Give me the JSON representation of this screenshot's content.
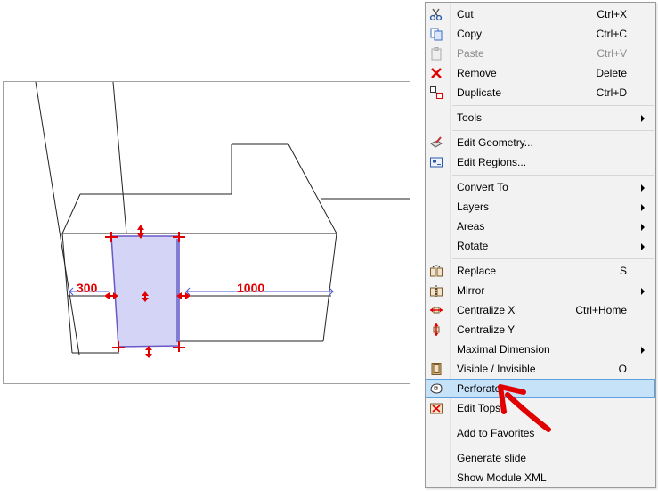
{
  "viewport": {
    "dimensions": [
      {
        "label": "300"
      },
      {
        "label": "1000"
      }
    ]
  },
  "menu": {
    "items": [
      {
        "kind": "item",
        "icon": "scissors-icon",
        "label": "Cut",
        "shortcut": "Ctrl+X",
        "submenu": false,
        "disabled": false
      },
      {
        "kind": "item",
        "icon": "copy-icon",
        "label": "Copy",
        "shortcut": "Ctrl+C",
        "submenu": false,
        "disabled": false
      },
      {
        "kind": "item",
        "icon": "paste-icon",
        "label": "Paste",
        "shortcut": "Ctrl+V",
        "submenu": false,
        "disabled": true
      },
      {
        "kind": "item",
        "icon": "remove-x-icon",
        "label": "Remove",
        "shortcut": "Delete",
        "submenu": false,
        "disabled": false
      },
      {
        "kind": "item",
        "icon": "duplicate-icon",
        "label": "Duplicate",
        "shortcut": "Ctrl+D",
        "submenu": false,
        "disabled": false
      },
      {
        "kind": "sep"
      },
      {
        "kind": "item",
        "icon": "",
        "label": "Tools",
        "shortcut": "",
        "submenu": true,
        "disabled": false
      },
      {
        "kind": "sep"
      },
      {
        "kind": "item",
        "icon": "edit-geometry-icon",
        "label": "Edit Geometry...",
        "shortcut": "",
        "submenu": false,
        "disabled": false
      },
      {
        "kind": "item",
        "icon": "edit-regions-icon",
        "label": "Edit Regions...",
        "shortcut": "",
        "submenu": false,
        "disabled": false
      },
      {
        "kind": "sep"
      },
      {
        "kind": "item",
        "icon": "",
        "label": "Convert To",
        "shortcut": "",
        "submenu": true,
        "disabled": false
      },
      {
        "kind": "item",
        "icon": "",
        "label": "Layers",
        "shortcut": "",
        "submenu": true,
        "disabled": false
      },
      {
        "kind": "item",
        "icon": "",
        "label": "Areas",
        "shortcut": "",
        "submenu": true,
        "disabled": false
      },
      {
        "kind": "item",
        "icon": "",
        "label": "Rotate",
        "shortcut": "",
        "submenu": true,
        "disabled": false
      },
      {
        "kind": "sep"
      },
      {
        "kind": "item",
        "icon": "replace-icon",
        "label": "Replace",
        "shortcut": "S",
        "submenu": false,
        "disabled": false
      },
      {
        "kind": "item",
        "icon": "mirror-icon",
        "label": "Mirror",
        "shortcut": "",
        "submenu": true,
        "disabled": false
      },
      {
        "kind": "item",
        "icon": "centralize-x-icon",
        "label": "Centralize X",
        "shortcut": "Ctrl+Home",
        "submenu": false,
        "disabled": false
      },
      {
        "kind": "item",
        "icon": "centralize-y-icon",
        "label": "Centralize Y",
        "shortcut": "",
        "submenu": false,
        "disabled": false
      },
      {
        "kind": "item",
        "icon": "",
        "label": "Maximal Dimension",
        "shortcut": "",
        "submenu": true,
        "disabled": false
      },
      {
        "kind": "item",
        "icon": "visible-toggle-icon",
        "label": "Visible / Invisible",
        "shortcut": "O",
        "submenu": false,
        "disabled": false
      },
      {
        "kind": "item",
        "icon": "perforate-icon",
        "label": "Perforate",
        "shortcut": "",
        "submenu": false,
        "disabled": false,
        "highlight": true
      },
      {
        "kind": "item",
        "icon": "edit-tops-icon",
        "label": "Edit Tops...",
        "shortcut": "",
        "submenu": false,
        "disabled": false
      },
      {
        "kind": "sep"
      },
      {
        "kind": "item",
        "icon": "",
        "label": "Add to Favorites",
        "shortcut": "",
        "submenu": false,
        "disabled": false
      },
      {
        "kind": "sep"
      },
      {
        "kind": "item",
        "icon": "",
        "label": "Generate slide",
        "shortcut": "",
        "submenu": false,
        "disabled": false
      },
      {
        "kind": "item",
        "icon": "",
        "label": "Show Module XML",
        "shortcut": "",
        "submenu": false,
        "disabled": false
      }
    ]
  },
  "colors": {
    "accent_red": "#e00000",
    "selection_fill": "#d4d4f7",
    "selection_stroke": "#6a58c8",
    "dimension_blue": "#4b52d6",
    "menu_highlight": "#c6e2f9"
  }
}
